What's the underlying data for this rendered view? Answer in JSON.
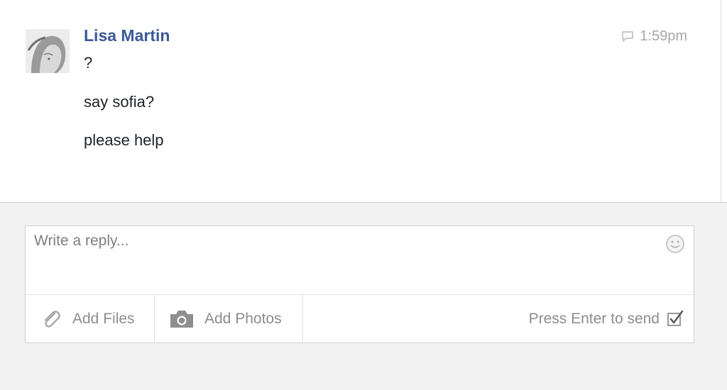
{
  "message": {
    "sender": "Lisa Martin",
    "time": "1:59pm",
    "lines": [
      "?",
      "say sofia?",
      "please help"
    ]
  },
  "composer": {
    "placeholder": "Write a reply...",
    "add_files_label": "Add Files",
    "add_photos_label": "Add Photos",
    "enter_to_send_label": "Press Enter to send",
    "enter_to_send_checked": true
  },
  "icons": {
    "avatar": "user-avatar",
    "time": "message-bubble-icon",
    "emoji": "smiley-icon",
    "files": "paperclip-icon",
    "photos": "camera-icon",
    "send": "checkbox-icon"
  },
  "colors": {
    "sender_name": "#3b5998",
    "muted_text": "#8d8d8d",
    "panel_bg": "#f2f2f2"
  }
}
